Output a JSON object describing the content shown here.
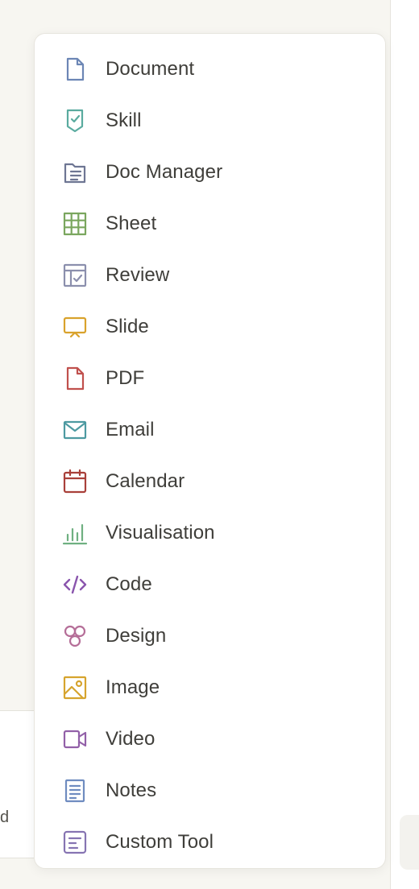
{
  "background_card": {
    "text": "d"
  },
  "menu": {
    "items": [
      {
        "id": "document",
        "label": "Document",
        "icon": "document-icon",
        "color": "#6c86b5"
      },
      {
        "id": "skill",
        "label": "Skill",
        "icon": "skill-icon",
        "color": "#5aab9f"
      },
      {
        "id": "doc-manager",
        "label": "Doc Manager",
        "icon": "folder-doc-icon",
        "color": "#6e7693"
      },
      {
        "id": "sheet",
        "label": "Sheet",
        "icon": "grid-icon",
        "color": "#7aa65e"
      },
      {
        "id": "review",
        "label": "Review",
        "icon": "review-icon",
        "color": "#8b8fad"
      },
      {
        "id": "slide",
        "label": "Slide",
        "icon": "presentation-icon",
        "color": "#d9a22c"
      },
      {
        "id": "pdf",
        "label": "PDF",
        "icon": "pdf-icon",
        "color": "#c0504d"
      },
      {
        "id": "email",
        "label": "Email",
        "icon": "envelope-icon",
        "color": "#4d9aa1"
      },
      {
        "id": "calendar",
        "label": "Calendar",
        "icon": "calendar-icon",
        "color": "#a9403a"
      },
      {
        "id": "visualisation",
        "label": "Visualisation",
        "icon": "bar-chart-icon",
        "color": "#6fb081"
      },
      {
        "id": "code",
        "label": "Code",
        "icon": "code-icon",
        "color": "#8a55ad"
      },
      {
        "id": "design",
        "label": "Design",
        "icon": "design-icon",
        "color": "#b56e98"
      },
      {
        "id": "image",
        "label": "Image",
        "icon": "image-icon",
        "color": "#d6a42e"
      },
      {
        "id": "video",
        "label": "Video",
        "icon": "video-icon",
        "color": "#9260a8"
      },
      {
        "id": "notes",
        "label": "Notes",
        "icon": "notes-icon",
        "color": "#6f8cc0"
      },
      {
        "id": "custom-tool",
        "label": "Custom Tool",
        "icon": "custom-tool-icon",
        "color": "#8674b2"
      }
    ]
  }
}
